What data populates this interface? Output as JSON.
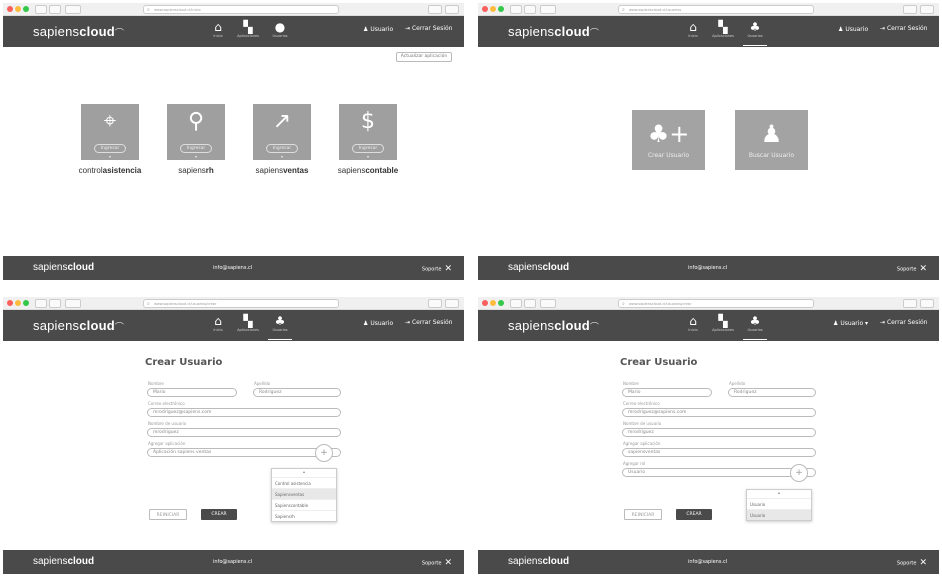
{
  "brand": {
    "logo_text": "sapiens",
    "logo_bold": "cloud",
    "footer_email": "info@sapiens.cl",
    "support_label": "Soporte",
    "footer_email_p1": "info@sapiens.cl",
    "support_label_p1": "Soporte"
  },
  "p1": {
    "url": "www.sapienscloud.cl/inicio",
    "nav": [
      {
        "label": "Inicio"
      },
      {
        "label": "Aplicaciones"
      },
      {
        "label": "Usuarios"
      }
    ],
    "user": "Usuario",
    "logout": "Cerrar Sesión",
    "update_button": "Actualizar aplicación",
    "apps": [
      {
        "ingresar": "Ingresar",
        "name_normal": "control",
        "name_bold": "asistencia"
      },
      {
        "ingresar": "Ingresar",
        "name_normal": "sapiens",
        "name_bold": "rh"
      },
      {
        "ingresar": "Ingresar",
        "name_normal": "sapiens",
        "name_bold": "ventas"
      },
      {
        "ingresar": "Ingresar",
        "name_normal": "sapiens",
        "name_bold": "contable"
      }
    ]
  },
  "p2": {
    "url": "www.sapienscloud.cl/usuarios",
    "nav": [
      {
        "label": "Inicio"
      },
      {
        "label": "Aplicaciones"
      },
      {
        "label": "Usuarios"
      }
    ],
    "user": "Usuario",
    "logout": "Cerrar Sesión",
    "tiles": [
      {
        "label": "Crear Usuario"
      },
      {
        "label": "Buscar Usuario"
      }
    ]
  },
  "p3": {
    "url": "www.sapienscloud.cl/usuarios/crear",
    "nav": [
      {
        "label": "Inicio"
      },
      {
        "label": "Aplicaciones"
      },
      {
        "label": "Usuarios"
      }
    ],
    "user": "Usuario",
    "logout": "Cerrar Sesión",
    "title": "Crear Usuario",
    "fields": {
      "nombre_label": "Nombre",
      "nombre_value": "Mario",
      "apellido_label": "Apellido",
      "apellido_value": "Rodriguez",
      "correo_label": "Correo electrónico",
      "correo_value": "mrodriguez@sapiens.com",
      "nombre_usuario_label": "Nombre de usuario",
      "nombre_usuario_value": "mrodriguez",
      "agregar_label": "Agregar aplicación",
      "agregar_value": "Aplicación sapiens ventas"
    },
    "dropdown": [
      {
        "label": "Control asistencia"
      },
      {
        "label": "Sapiensventas"
      },
      {
        "label": "Sapienscontable"
      },
      {
        "label": "Sapiensrh"
      }
    ],
    "reset_button": "REINICIAR",
    "create_button": "CREAR"
  },
  "p4": {
    "url": "www.sapienscloud.cl/usuarios/crear",
    "nav": [
      {
        "label": "Inicio"
      },
      {
        "label": "Aplicaciones"
      },
      {
        "label": "Usuarios"
      }
    ],
    "user": "Usuario",
    "logout": "Cerrar Sesión",
    "title": "Crear Usuario",
    "fields": {
      "nombre_label": "Nombre",
      "nombre_value": "Mario",
      "apellido_label": "Apellido",
      "apellido_value": "Rodriguez",
      "correo_label": "Correo electrónico",
      "correo_value": "mrodriguez@sapiens.com",
      "nombre_usuario_label": "Nombre de usuario",
      "nombre_usuario_value": "mrodriguez",
      "agregar_label": "Agregar aplicación",
      "agregar_value": "sapiensventas",
      "agregar2_label": "Agregar rol",
      "agregar2_value": "Usuario"
    },
    "dropdown": [
      {
        "label": "Usuario"
      },
      {
        "label": "Usuario"
      }
    ],
    "reset_button": "REINICIAR",
    "create_button": "CREAR"
  },
  "colors": {
    "appbar": "#4a4a4a",
    "tile": "#9f9f9f"
  }
}
